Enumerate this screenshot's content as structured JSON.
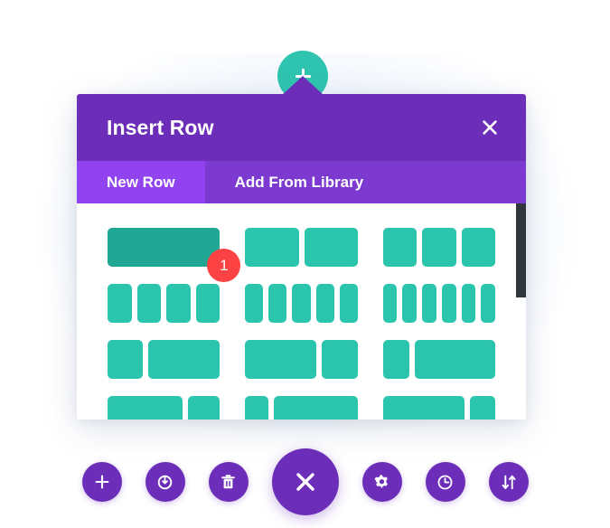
{
  "canvas": {
    "background_color": "#ffffff"
  },
  "add_button": {
    "icon": "plus-icon",
    "color": "#2ec4b0",
    "label": "+"
  },
  "modal": {
    "title": "Insert Row",
    "accent_color": "#6c2eb9",
    "tabs_bar_color": "#7c3ad0",
    "active_tab_color": "#9143ef",
    "close_icon": "close-icon",
    "tabs": [
      {
        "label": "New Row",
        "active": true
      },
      {
        "label": "Add From Library",
        "active": false
      }
    ],
    "badge": {
      "text": "1",
      "color": "#fc4242"
    },
    "block_color": "#2bc4ad",
    "block_hover_color": "#20a894",
    "scrollbar_color": "#31363d",
    "layout_rows": [
      {
        "options": [
          {
            "name": "one-column",
            "widths": [
              100
            ],
            "hovered": true,
            "badge": "1"
          },
          {
            "name": "two-columns",
            "widths": [
              50,
              50
            ],
            "hovered": false
          },
          {
            "name": "three-columns",
            "widths": [
              33.33,
              33.33,
              33.33
            ],
            "hovered": false
          }
        ]
      },
      {
        "options": [
          {
            "name": "four-columns",
            "widths": [
              25,
              25,
              25,
              25
            ],
            "hovered": false
          },
          {
            "name": "five-columns",
            "widths": [
              20,
              20,
              20,
              20,
              20
            ],
            "hovered": false
          },
          {
            "name": "six-columns",
            "widths": [
              16.66,
              16.66,
              16.66,
              16.66,
              16.66,
              16.66
            ],
            "hovered": false
          }
        ]
      },
      {
        "options": [
          {
            "name": "one-third-two-thirds",
            "widths": [
              33.33,
              66.66
            ],
            "hovered": false
          },
          {
            "name": "two-thirds-one-third",
            "widths": [
              66.66,
              33.33
            ],
            "hovered": false
          },
          {
            "name": "one-quarter-three-quarters",
            "widths": [
              25,
              75
            ],
            "hovered": false
          }
        ]
      },
      {
        "options": [
          {
            "name": "three-quarters-one-quarter",
            "widths": [
              70,
              30
            ],
            "hovered": false
          },
          {
            "name": "one-quarter-three-quarters-alt",
            "widths": [
              22,
              78
            ],
            "hovered": false
          },
          {
            "name": "three-quarters-one-quarter-alt",
            "widths": [
              76,
              24
            ],
            "hovered": false
          }
        ]
      }
    ]
  },
  "toolbar": {
    "color": "#6c2eb9",
    "buttons": [
      {
        "name": "add-button",
        "icon": "plus-icon",
        "primary": false
      },
      {
        "name": "toggle-visibility-button",
        "icon": "power-icon",
        "primary": false
      },
      {
        "name": "delete-button",
        "icon": "trash-icon",
        "primary": false
      },
      {
        "name": "close-builder-button",
        "icon": "close-icon",
        "primary": true
      },
      {
        "name": "settings-button",
        "icon": "gear-icon",
        "primary": false
      },
      {
        "name": "history-button",
        "icon": "clock-icon",
        "primary": false
      },
      {
        "name": "sort-button",
        "icon": "sort-arrows-icon",
        "primary": false
      }
    ]
  }
}
